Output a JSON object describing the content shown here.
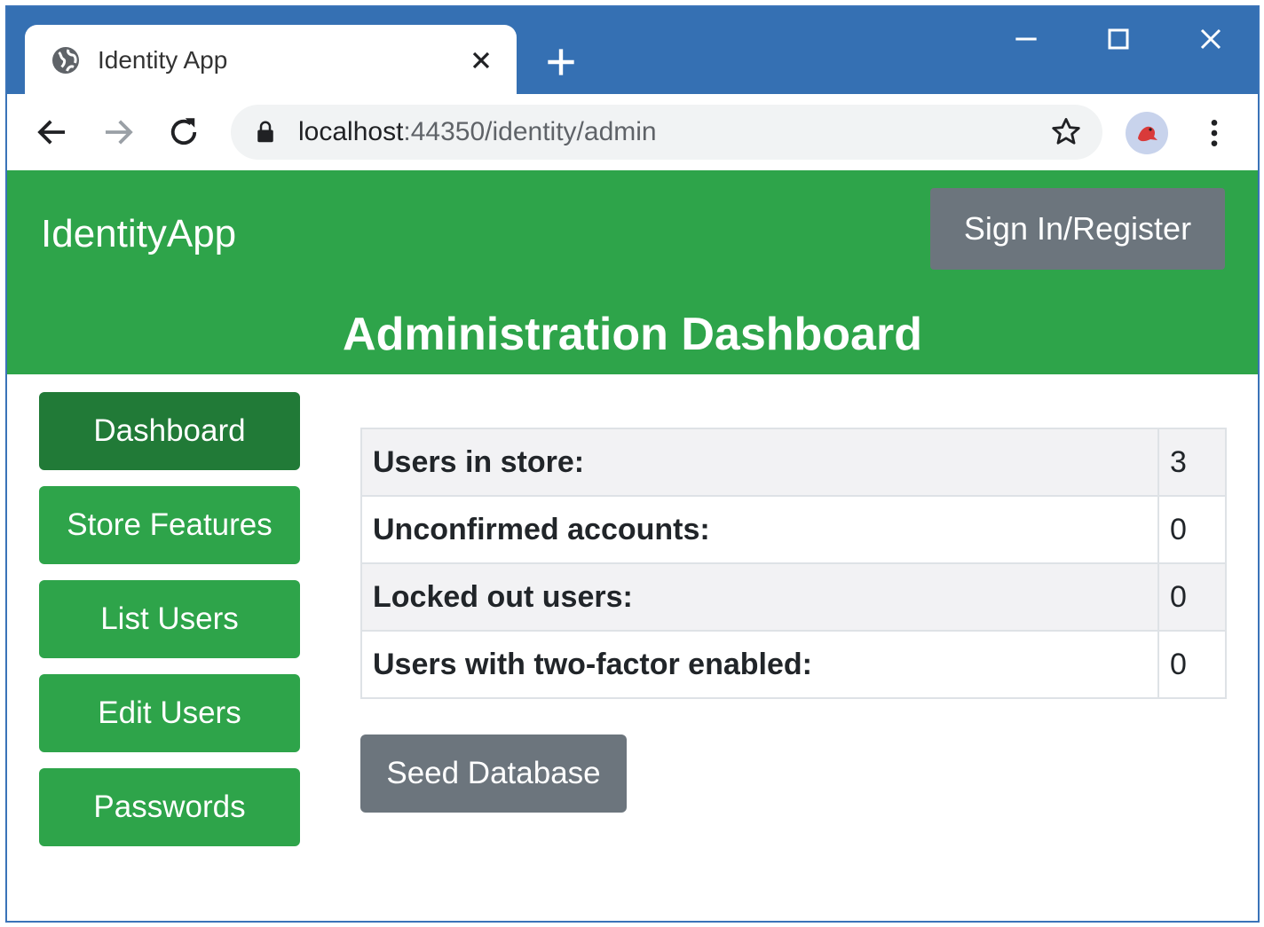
{
  "browser": {
    "tab_title": "Identity App",
    "url_host": "localhost",
    "url_rest": ":44350/identity/admin"
  },
  "app": {
    "brand": "IdentityApp",
    "signin_label": "Sign In/Register",
    "page_title": "Administration Dashboard"
  },
  "sidebar": {
    "items": [
      {
        "label": "Dashboard",
        "active": true
      },
      {
        "label": "Store Features",
        "active": false
      },
      {
        "label": "List Users",
        "active": false
      },
      {
        "label": "Edit Users",
        "active": false
      },
      {
        "label": "Passwords",
        "active": false
      }
    ]
  },
  "stats": {
    "rows": [
      {
        "label": "Users in store:",
        "value": "3"
      },
      {
        "label": "Unconfirmed accounts:",
        "value": "0"
      },
      {
        "label": "Locked out users:",
        "value": "0"
      },
      {
        "label": "Users with two-factor enabled:",
        "value": "0"
      }
    ]
  },
  "actions": {
    "seed_label": "Seed Database"
  },
  "colors": {
    "banner": "#2ea44a",
    "active_nav": "#217a37",
    "secondary_button": "#6c757d",
    "titlebar": "#3570b3"
  },
  "icons": {
    "tab": "globe-icon",
    "close": "close-icon",
    "new_tab": "plus-icon",
    "back": "back-arrow-icon",
    "forward": "forward-arrow-icon",
    "reload": "reload-icon",
    "lock": "lock-icon",
    "bookmark": "star-icon",
    "menu": "kebab-menu-icon"
  }
}
